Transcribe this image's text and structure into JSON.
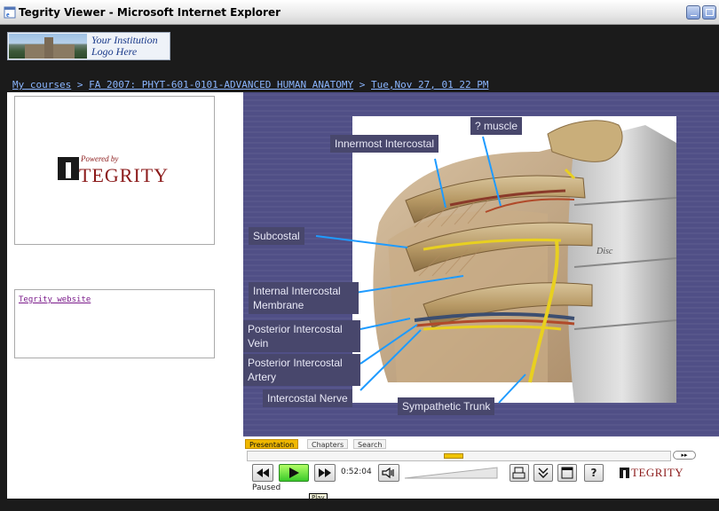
{
  "window": {
    "title": "Tegrity Viewer - Microsoft Internet Explorer"
  },
  "header": {
    "institution_logo_text": "Your Institution Logo Here"
  },
  "breadcrumb": {
    "items": [
      "My courses",
      "FA 2007: PHYT-601-0101-ADVANCED HUMAN ANATOMY",
      "Tue,Nov 27, 01 22 PM"
    ],
    "separator": ">"
  },
  "sidebar": {
    "powered_by": "Powered by",
    "brand": "TEGRITY",
    "website_link": "Tegrity website"
  },
  "slide": {
    "labels": {
      "question_muscle": "? muscle",
      "innermost_intercostal": "Innermost Intercostal",
      "subcostal": "Subcostal",
      "internal_intercostal_membrane": "Internal Intercostal Membrane",
      "posterior_intercostal_vein": "Posterior Intercostal Vein",
      "posterior_intercostal_artery": "Posterior Intercostal Artery",
      "intercostal_nerve": "Intercostal Nerve",
      "sympathetic_trunk": "Sympathetic Trunk",
      "disc": "Disc"
    }
  },
  "player": {
    "tabs": [
      "Presentation",
      "Chapters",
      "Search"
    ],
    "active_tab": "Presentation",
    "time": "0:52:04",
    "status": "Paused",
    "tooltip": "Play",
    "brand": "TEGRITY",
    "speed_label": "▸▸",
    "progress_fraction": 0.49,
    "help_label": "?"
  },
  "colors": {
    "slide_background": "#504f86",
    "label_background": "#48476c",
    "accent": "#f0b800",
    "brand_red": "#8b1a1a",
    "link_blue": "#8bb6ff"
  },
  "icons": [
    "ie-page-icon",
    "minimize-icon",
    "maximize-icon",
    "rewind-icon",
    "play-icon",
    "fast-forward-icon",
    "speaker-icon",
    "print-icon",
    "chevron-down-icon",
    "window-icon",
    "help-icon"
  ]
}
